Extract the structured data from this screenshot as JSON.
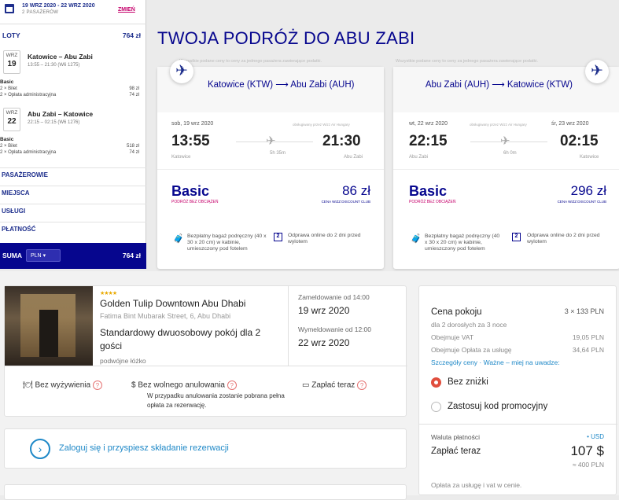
{
  "sidebar": {
    "dates": "19 WRZ 2020 - 22 WRZ 2020",
    "pax": "2 PASAŻERÓW",
    "change": "ZMIEŃ",
    "flights": {
      "label": "LOTY",
      "price": "764 zł"
    },
    "outbound": {
      "month": "WRZ",
      "day": "19",
      "route": "Katowice – Abu Zabi",
      "time": "13:55 – 21:30 (W6 1275)",
      "fare": "Basic",
      "line1": "2 × Bilet",
      "line1_price": "98 zł",
      "line2": "2 × Opłata administracyjna",
      "line2_price": "74 zł"
    },
    "inbound": {
      "month": "WRZ",
      "day": "22",
      "route": "Abu Zabi – Katowice",
      "time": "22:15 – 02:15 (W6 1276)",
      "fare": "Basic",
      "line1": "2 × Bilet",
      "line1_price": "518 zł",
      "line2": "2 × Opłata administracyjna",
      "line2_price": "74 zł"
    },
    "sections": [
      "PASAŻEROWIE",
      "MIEJSCA",
      "USŁUGI",
      "PŁATNOŚĆ"
    ],
    "total": {
      "label": "SUMA",
      "currency": "PLN",
      "price": "764 zł"
    }
  },
  "trip": {
    "title": "TWOJA PODRÓŻ DO ABU ZABI",
    "note": "Wszystkie podane ceny to ceny za jednego pasażera zawierające podatki.",
    "outbound": {
      "route": "Katowice (KTW) ⟶ Abu Zabi (AUH)",
      "date_dep": "sob, 19 wrz 2020",
      "operator": "obsługiwany przez Wizz Air Hungary",
      "dep": "13:55",
      "arr": "21:30",
      "from": "Katowice",
      "to": "Abu Zabi",
      "duration": "5h 35m",
      "fare": "Basic",
      "fare_sub": "PODRÓŻ BEZ OBCIĄŻEŃ",
      "price": "86 zł",
      "club": "CENA WIZZ DISCOUNT CLUB",
      "perk1": "Bezpłatny bagaż podręczny (40 x 30 x 20 cm) w kabinie, umieszczony pod fotelem",
      "perk2": "Odprawa online do 2 dni przed wylotem"
    },
    "inbound": {
      "route": "Abu Zabi (AUH) ⟶ Katowice (KTW)",
      "date_dep": "wt, 22 wrz 2020",
      "operator": "obsługiwany przez Wizz Air Hungary",
      "date_arr": "śr, 23 wrz 2020",
      "dep": "22:15",
      "arr": "02:15",
      "from": "Abu Zabi",
      "to": "Katowice",
      "duration": "6h 0m",
      "fare": "Basic",
      "fare_sub": "PODRÓŻ BEZ OBCIĄŻEŃ",
      "price": "296 zł",
      "club": "CENA WIZZ DISCOUNT CLUB",
      "perk1": "Bezpłatny bagaż podręczny (40 x 30 x 20 cm) w kabinie, umieszczony pod fotelem",
      "perk2": "Odprawa online do 2 dni przed wylotem"
    }
  },
  "hotel": {
    "stars": "★★★★",
    "name": "Golden Tulip Downtown Abu Dhabi",
    "address": "Fatima Bint Mubarak Street, 6, Abu Dhabi",
    "room": "Standardowy dwuosobowy pokój dla 2 gości",
    "bed": "podwójne łóżko",
    "checkin_label": "Zameldowanie od 14:00",
    "checkin": "19 wrz 2020",
    "checkout_label": "Wymeldowanie od 12:00",
    "checkout": "22 wrz 2020",
    "meal": "Bez wyżywienia",
    "cancel": "Bez wolnego anulowania",
    "cancel_sub": "W przypadku anulowania zostanie pobrana pełna opłata za rezerwację.",
    "pay": "Zapłać teraz",
    "login": "Zaloguj się i przyspiesz składanie rezerwacji"
  },
  "price": {
    "room_label": "Cena pokoju",
    "room_value": "3 × 133 PLN",
    "room_sub": "dla 2 dorosłych za 3 noce",
    "vat_label": "Obejmuje VAT",
    "vat_value": "19,05 PLN",
    "fee_label": "Obejmuje Opłata za usługę",
    "fee_value": "34,64 PLN",
    "details": "Szczegóły ceny · Ważne – miej na uwadze:",
    "radio1": "Bez zniżki",
    "radio2": "Zastosuj kod promocyjny",
    "currency_label": "Waluta płatności",
    "currency_value": "• USD",
    "pay_label": "Zapłać teraz",
    "pay_value": "107 $",
    "pay_sub": "≈ 400 PLN",
    "footer": "Opłata za usługę i vat w cenie."
  },
  "colors": {
    "brand": "#06068e",
    "accent": "#c5006b",
    "link": "#1e88c7",
    "radio": "#e04e3d"
  }
}
